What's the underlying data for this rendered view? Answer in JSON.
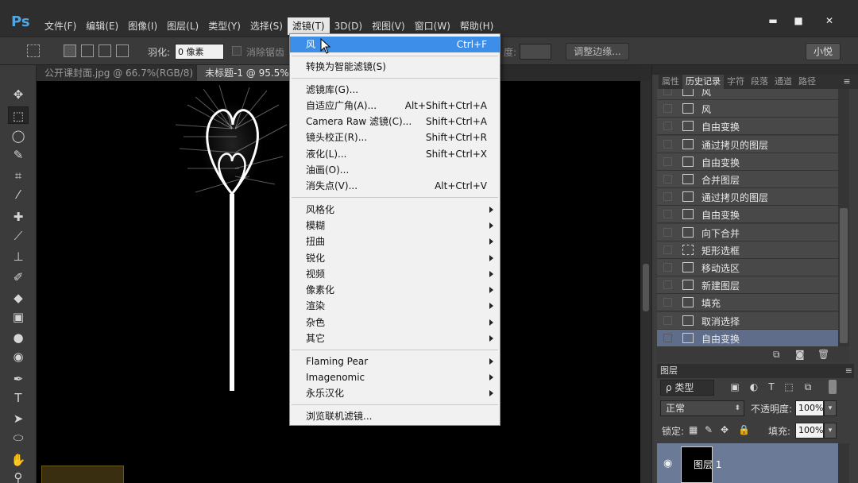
{
  "app": {
    "logo": "Ps"
  },
  "menubar": {
    "items": [
      "文件(F)",
      "编辑(E)",
      "图像(I)",
      "图层(L)",
      "类型(Y)",
      "选择(S)",
      "滤镜(T)",
      "3D(D)",
      "视图(V)",
      "窗口(W)",
      "帮助(H)"
    ],
    "active_index": 6
  },
  "window_controls": {
    "minimize": "▬",
    "maximize": "■",
    "close": "✕"
  },
  "options_bar": {
    "feather_label": "羽化:",
    "feather_value": "0 像素",
    "antialias_label": "消除锯齿",
    "density_label": "度:",
    "refine_edge_button": "调整边缘...",
    "small_button": "小悦"
  },
  "doc_tabs": [
    "公开课封面.jpg @ 66.7%(RGB/8)",
    "未标题-1 @ 95.5% ("
  ],
  "filter_menu": {
    "items": [
      {
        "label": "风",
        "shortcut": "Ctrl+F",
        "highlighted": true
      },
      {
        "label": "转换为智能滤镜(S)"
      },
      {
        "label": "滤镜库(G)..."
      },
      {
        "label": "自适应广角(A)...",
        "shortcut": "Alt+Shift+Ctrl+A"
      },
      {
        "label": "Camera Raw 滤镜(C)...",
        "shortcut": "Shift+Ctrl+A"
      },
      {
        "label": "镜头校正(R)...",
        "shortcut": "Shift+Ctrl+R"
      },
      {
        "label": "液化(L)...",
        "shortcut": "Shift+Ctrl+X"
      },
      {
        "label": "油画(O)..."
      },
      {
        "label": "消失点(V)...",
        "shortcut": "Alt+Ctrl+V"
      },
      {
        "label": "风格化",
        "submenu": true
      },
      {
        "label": "模糊",
        "submenu": true
      },
      {
        "label": "扭曲",
        "submenu": true
      },
      {
        "label": "锐化",
        "submenu": true
      },
      {
        "label": "视频",
        "submenu": true
      },
      {
        "label": "像素化",
        "submenu": true
      },
      {
        "label": "渲染",
        "submenu": true
      },
      {
        "label": "杂色",
        "submenu": true
      },
      {
        "label": "其它",
        "submenu": true
      },
      {
        "label": "Flaming Pear",
        "submenu": true
      },
      {
        "label": "Imagenomic",
        "submenu": true
      },
      {
        "label": "永乐汉化",
        "submenu": true
      },
      {
        "label": "浏览联机滤镜..."
      }
    ]
  },
  "right_panel": {
    "tabs": [
      "属性",
      "历史记录",
      "字符",
      "段落",
      "通道",
      "路径"
    ],
    "active_tab_index": 1,
    "menu_icon": "≡",
    "history": [
      {
        "label": "风",
        "icon": "document-icon"
      },
      {
        "label": "风",
        "icon": "document-icon"
      },
      {
        "label": "自由变换",
        "icon": "document-icon"
      },
      {
        "label": "通过拷贝的图层",
        "icon": "document-icon"
      },
      {
        "label": "自由变换",
        "icon": "document-icon"
      },
      {
        "label": "合并图层",
        "icon": "document-icon"
      },
      {
        "label": "通过拷贝的图层",
        "icon": "document-icon"
      },
      {
        "label": "自由变换",
        "icon": "document-icon"
      },
      {
        "label": "向下合并",
        "icon": "document-icon"
      },
      {
        "label": "矩形选框",
        "icon": "marquee-icon"
      },
      {
        "label": "移动选区",
        "icon": "document-icon"
      },
      {
        "label": "新建图层",
        "icon": "document-icon"
      },
      {
        "label": "填充",
        "icon": "fill-icon"
      },
      {
        "label": "取消选择",
        "icon": "document-icon"
      },
      {
        "label": "自由变换",
        "icon": "document-icon",
        "selected": true
      }
    ],
    "layers": {
      "title": "图层",
      "filter_label": "ρ 类型",
      "blend_mode": "正常",
      "opacity_label": "不透明度:",
      "opacity_value": "100%",
      "lock_label": "锁定:",
      "fill_label": "填充:",
      "fill_value": "100%",
      "layer_name": "图层 1"
    }
  },
  "colors": {
    "menu_highlight": "#3d8ee8",
    "history_selected": "#606d8a",
    "layer_selected": "#6b7a97",
    "ps_blue": "#4fa6e0"
  }
}
